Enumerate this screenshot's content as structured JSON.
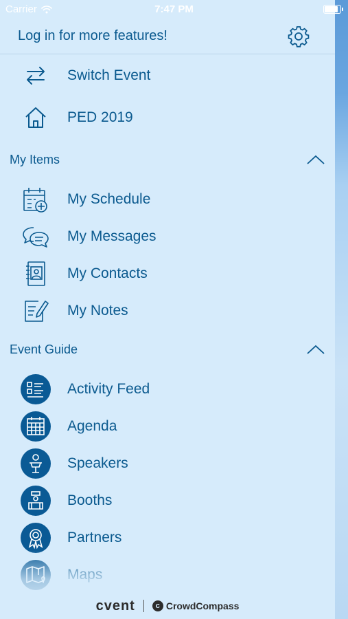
{
  "status_bar": {
    "carrier": "Carrier",
    "time": "7:47 PM"
  },
  "header": {
    "title": "Log in for more features!",
    "settings_icon": "gear-icon"
  },
  "top_items": [
    {
      "label": "Switch Event",
      "icon": "switch-arrows-icon"
    },
    {
      "label": "PED 2019",
      "icon": "home-icon"
    }
  ],
  "my_items": {
    "title": "My Items",
    "items": [
      {
        "label": "My Schedule",
        "icon": "calendar-add-icon"
      },
      {
        "label": "My Messages",
        "icon": "chat-bubbles-icon"
      },
      {
        "label": "My Contacts",
        "icon": "address-book-icon"
      },
      {
        "label": "My Notes",
        "icon": "note-edit-icon"
      }
    ]
  },
  "event_guide": {
    "title": "Event Guide",
    "items": [
      {
        "label": "Activity Feed",
        "icon": "activity-list-icon"
      },
      {
        "label": "Agenda",
        "icon": "agenda-calendar-icon"
      },
      {
        "label": "Speakers",
        "icon": "speaker-podium-icon"
      },
      {
        "label": "Booths",
        "icon": "booth-icon"
      },
      {
        "label": "Partners",
        "icon": "ribbon-award-icon"
      },
      {
        "label": "Maps",
        "icon": "map-pin-icon"
      }
    ]
  },
  "footer": {
    "brand": "cvent",
    "product": "CrowdCompass"
  },
  "colors": {
    "accent": "#0b5a8f",
    "background": "#d6ebfb",
    "icon_circle": "#0a5a95"
  }
}
